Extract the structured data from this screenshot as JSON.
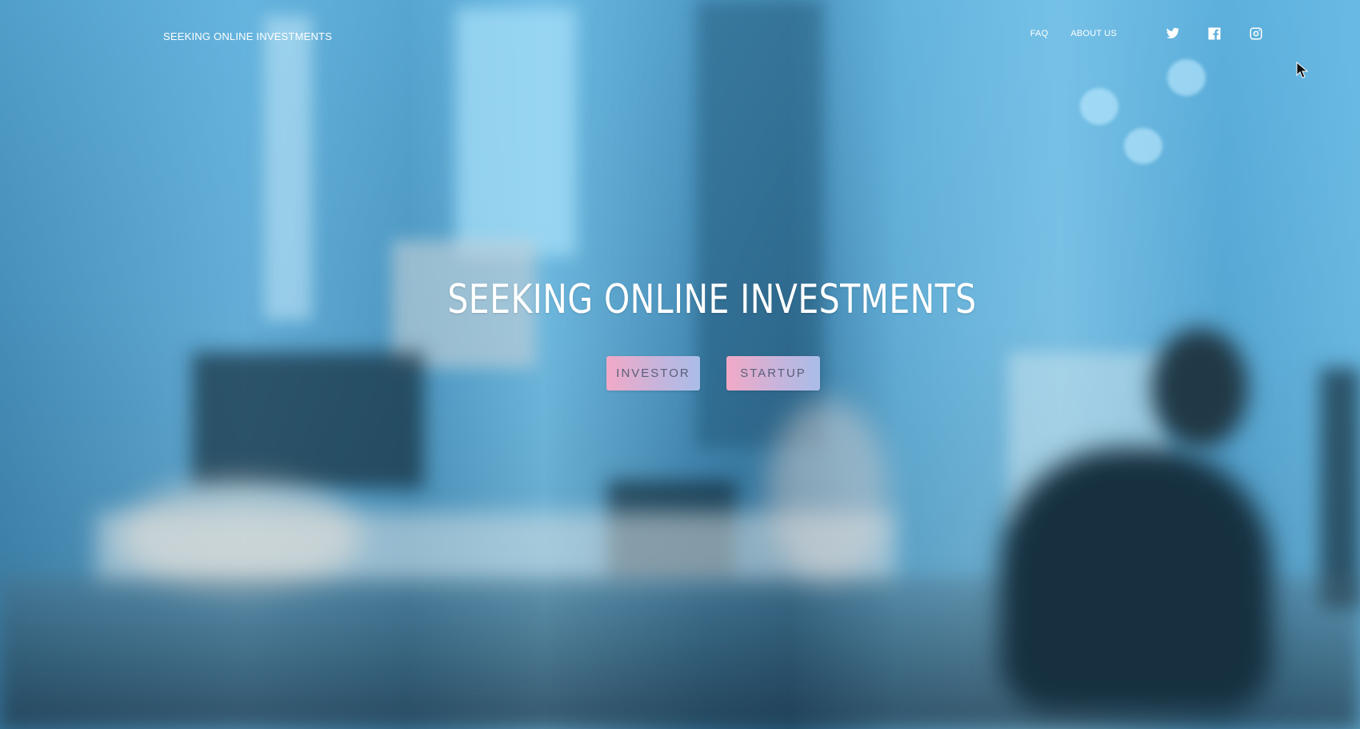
{
  "nav": {
    "brand": "SEEKING ONLINE INVESTMENTS",
    "links": [
      {
        "label": "FAQ"
      },
      {
        "label": "ABOUT US"
      }
    ],
    "social": [
      {
        "icon": "twitter-icon"
      },
      {
        "icon": "facebook-icon"
      },
      {
        "icon": "instagram-icon"
      }
    ]
  },
  "hero": {
    "title": "SEEKING ONLINE INVESTMENTS",
    "buttons": {
      "investor": "INVESTOR",
      "startup": "STARTUP"
    }
  },
  "colors": {
    "text": "#ffffff",
    "button_gradient_start": "#f2a9c6",
    "button_gradient_end": "#a9bde8",
    "button_text": "#5b5f79"
  }
}
